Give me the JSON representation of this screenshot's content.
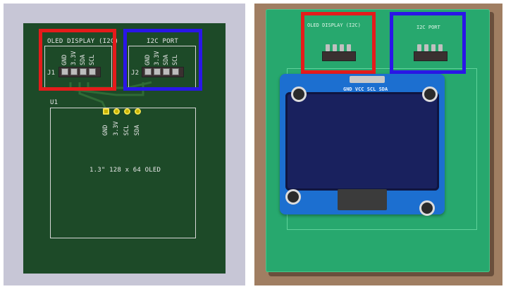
{
  "pcb_layout": {
    "j1": {
      "title": "OLED DISPLAY (I2C)",
      "ref": "J1",
      "pins": [
        "GND",
        "3.3V",
        "SDA",
        "SCL"
      ]
    },
    "j2": {
      "title": "I2C PORT",
      "ref": "J2",
      "pins": [
        "GND",
        "3.3V",
        "SDA",
        "SCL"
      ]
    },
    "u1": {
      "ref": "U1",
      "pins": [
        "GND",
        "3.3V",
        "SCL",
        "SDA"
      ],
      "label": "1.3\" 128 x 64 OLED"
    }
  },
  "photo": {
    "header_left": "OLED DISPLAY (I2C)",
    "header_right": "I2C PORT",
    "module_pins_label": "GND VCC SCL SDA"
  },
  "colors": {
    "highlight_red": "#e51b1b",
    "highlight_blue": "#2a16e8",
    "board_green": "#1d4a28",
    "photo_board": "#27a86e",
    "oled_module": "#1c6fd0"
  }
}
